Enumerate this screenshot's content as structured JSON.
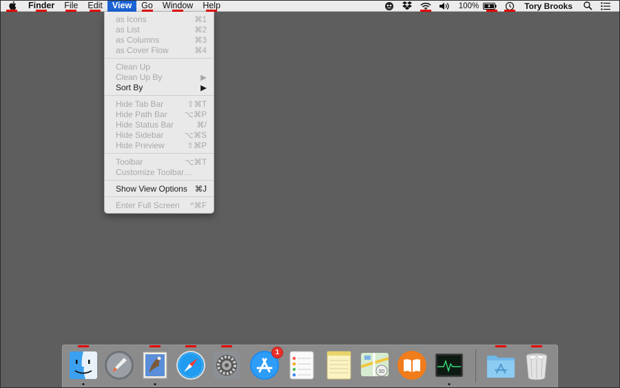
{
  "menubar": {
    "apple_icon": "apple-logo",
    "app_name": "Finder",
    "menus": [
      "File",
      "Edit",
      "View",
      "Go",
      "Window",
      "Help"
    ],
    "active_menu": "View",
    "status": {
      "battery_percent": "100%",
      "user_name": "Tory Brooks"
    }
  },
  "view_menu": {
    "items": [
      {
        "label": "as Icons",
        "shortcut": "⌘1",
        "enabled": false
      },
      {
        "label": "as List",
        "shortcut": "⌘2",
        "enabled": false
      },
      {
        "label": "as Columns",
        "shortcut": "⌘3",
        "enabled": false
      },
      {
        "label": "as Cover Flow",
        "shortcut": "⌘4",
        "enabled": false
      },
      {
        "separator": true
      },
      {
        "label": "Clean Up",
        "shortcut": "",
        "enabled": false
      },
      {
        "label": "Clean Up By",
        "shortcut": "▶",
        "enabled": false
      },
      {
        "label": "Sort By",
        "shortcut": "▶",
        "enabled": true
      },
      {
        "separator": true
      },
      {
        "label": "Hide Tab Bar",
        "shortcut": "⇧⌘T",
        "enabled": false
      },
      {
        "label": "Hide Path Bar",
        "shortcut": "⌥⌘P",
        "enabled": false
      },
      {
        "label": "Hide Status Bar",
        "shortcut": "⌘/",
        "enabled": false
      },
      {
        "label": "Hide Sidebar",
        "shortcut": "⌥⌘S",
        "enabled": false
      },
      {
        "label": "Hide Preview",
        "shortcut": "⇧⌘P",
        "enabled": false
      },
      {
        "separator": true
      },
      {
        "label": "Toolbar",
        "shortcut": "⌥⌘T",
        "enabled": false
      },
      {
        "label": "Customize Toolbar…",
        "shortcut": "",
        "enabled": false
      },
      {
        "separator": true
      },
      {
        "label": "Show View Options",
        "shortcut": "⌘J",
        "enabled": true
      },
      {
        "separator": true
      },
      {
        "label": "Enter Full Screen",
        "shortcut": "^⌘F",
        "enabled": false
      }
    ]
  },
  "dock": {
    "apps": [
      {
        "name": "finder-icon",
        "running": true,
        "marked": true
      },
      {
        "name": "launchpad-icon",
        "running": false,
        "marked": false
      },
      {
        "name": "mail-icon",
        "running": true,
        "marked": true
      },
      {
        "name": "safari-icon",
        "running": false,
        "marked": true
      },
      {
        "name": "system-preferences-icon",
        "running": false,
        "marked": true
      },
      {
        "name": "app-store-icon",
        "running": false,
        "marked": false,
        "badge": "1"
      },
      {
        "name": "reminders-icon",
        "running": false,
        "marked": false
      },
      {
        "name": "notes-icon",
        "running": false,
        "marked": false
      },
      {
        "name": "maps-icon",
        "running": false,
        "marked": false
      },
      {
        "name": "ibooks-icon",
        "running": false,
        "marked": false
      },
      {
        "name": "activity-monitor-icon",
        "running": true,
        "marked": false
      },
      {
        "name": "applications-folder-icon",
        "running": false,
        "marked": true
      },
      {
        "name": "trash-icon",
        "running": false,
        "marked": true
      }
    ]
  },
  "colors": {
    "desktop": "#5e5e5e",
    "menu_highlight": "#1c63d5",
    "annotation_red": "#e40000"
  }
}
